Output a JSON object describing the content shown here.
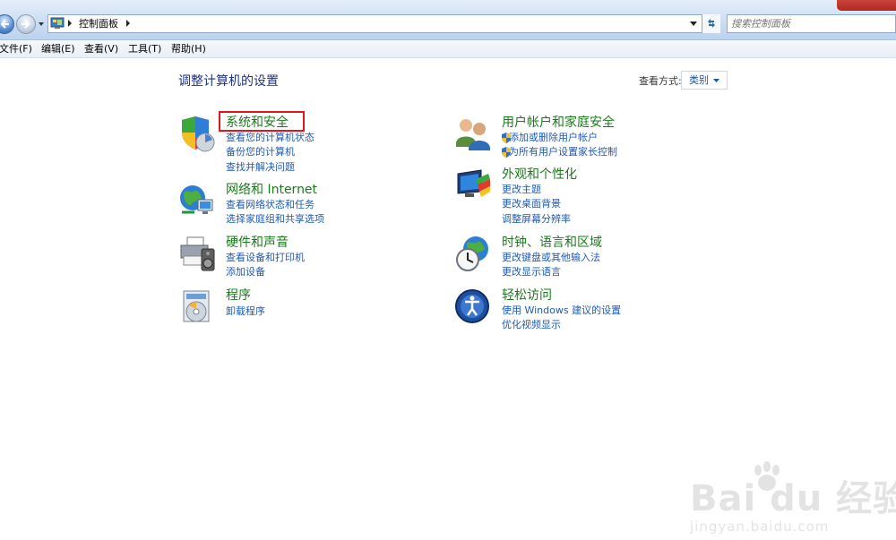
{
  "address_bar": {
    "breadcrumb": "控制面板",
    "search_placeholder": "搜索控制面板"
  },
  "menu": {
    "items": [
      "文件(F)",
      "编辑(E)",
      "查看(V)",
      "工具(T)",
      "帮助(H)"
    ]
  },
  "content": {
    "title": "调整计算机的设置",
    "view_by_label": "查看方式:",
    "view_by_value": "类别"
  },
  "categories": [
    {
      "id": "system-security",
      "title": "系统和安全",
      "icon": "shield-chart-icon",
      "links": [
        "查看您的计算机状态",
        "备份您的计算机",
        "查找并解决问题"
      ]
    },
    {
      "id": "network-internet",
      "title": "网络和 Internet",
      "icon": "globe-network-icon",
      "links": [
        "查看网络状态和任务",
        "选择家庭组和共享选项"
      ]
    },
    {
      "id": "hardware-sound",
      "title": "硬件和声音",
      "icon": "printer-speaker-icon",
      "links": [
        "查看设备和打印机",
        "添加设备"
      ]
    },
    {
      "id": "programs",
      "title": "程序",
      "icon": "programs-disc-icon",
      "links": [
        "卸载程序"
      ]
    },
    {
      "id": "user-accounts",
      "title": "用户帐户和家庭安全",
      "icon": "users-icon",
      "links": [
        "添加或删除用户帐户",
        "为所有用户设置家长控制"
      ],
      "links_shielded": true
    },
    {
      "id": "appearance",
      "title": "外观和个性化",
      "icon": "monitor-palette-icon",
      "links": [
        "更改主题",
        "更改桌面背景",
        "调整屏幕分辨率"
      ]
    },
    {
      "id": "clock-region",
      "title": "时钟、语言和区域",
      "icon": "clock-globe-icon",
      "links": [
        "更改键盘或其他输入法",
        "更改显示语言"
      ]
    },
    {
      "id": "ease-access",
      "title": "轻松访问",
      "icon": "ease-of-access-icon",
      "links": [
        "使用 Windows 建议的设置",
        "优化视频显示"
      ]
    }
  ],
  "watermark": {
    "brand": "Bai du 经验",
    "url": "jingyan.baidu.com"
  },
  "colors": {
    "title_blue": "#1e3287",
    "category_green": "#1b7a1b",
    "link_blue": "#1e5bb8",
    "highlight_red": "#e4161b"
  }
}
